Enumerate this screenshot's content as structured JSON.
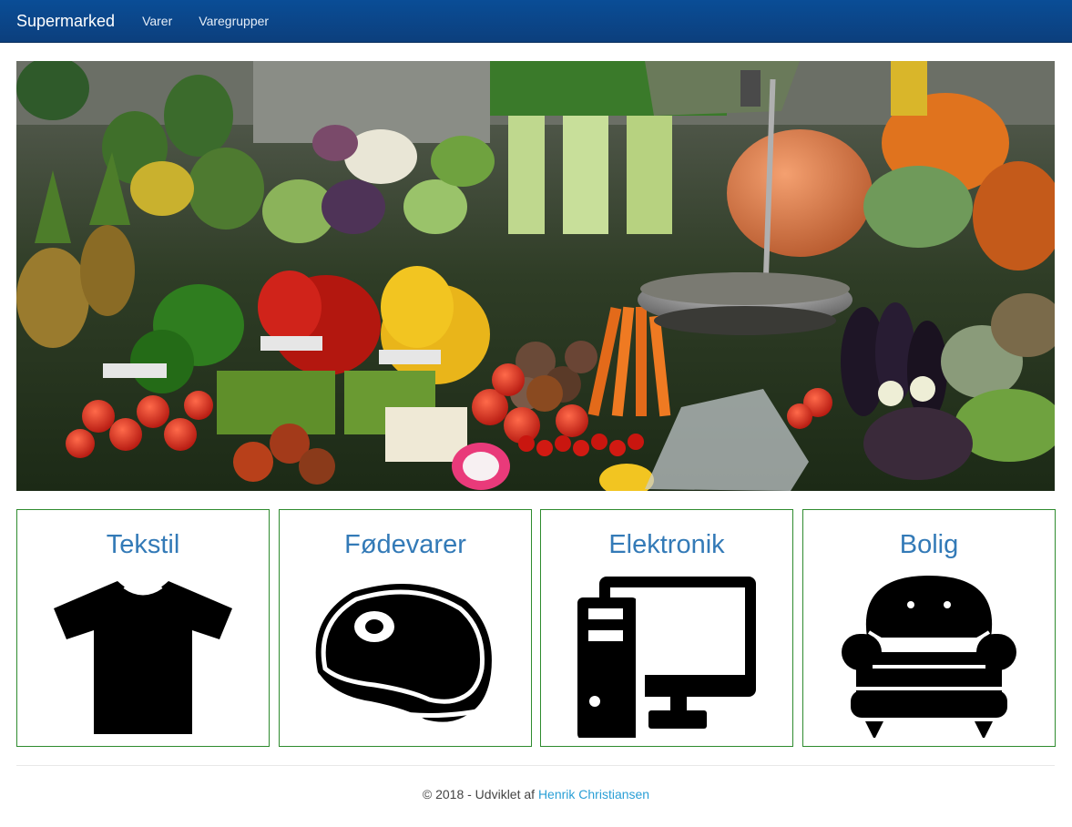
{
  "navbar": {
    "brand": "Supermarked",
    "links": [
      "Varer",
      "Varegrupper"
    ],
    "background": "#0b4688"
  },
  "hero": {
    "icon": "vegetable-market-photo"
  },
  "categories": [
    {
      "title": "Tekstil",
      "icon": "tshirt-icon"
    },
    {
      "title": "Fødevarer",
      "icon": "steak-icon"
    },
    {
      "title": "Elektronik",
      "icon": "desktop-computer-icon"
    },
    {
      "title": "Bolig",
      "icon": "armchair-icon"
    }
  ],
  "footer": {
    "prefix": "© 2018 - Udviklet af",
    "author": "Henrik Christiansen"
  },
  "colors": {
    "card_border": "#2e8b2e",
    "title": "#337ab7",
    "link": "#2a9fd6"
  }
}
